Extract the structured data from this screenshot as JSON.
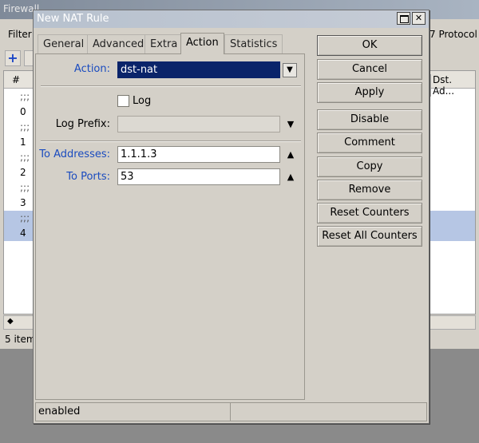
{
  "background": {
    "window_title": "Firewall",
    "tab_filter": "Filter",
    "tab_protocol": "7 Protocol",
    "col_hash": "#",
    "col_dst": "Dst. Ad...",
    "rows": [
      ";;;",
      "0",
      ";;;",
      "1",
      ";;;",
      "2",
      ";;;",
      "3",
      ";;;",
      "4"
    ],
    "status": "5 item"
  },
  "dialog": {
    "title": "New NAT Rule",
    "tabs": [
      "General",
      "Advanced",
      "Extra",
      "Action",
      "Statistics"
    ],
    "active_tab": "Action",
    "action_label": "Action:",
    "action_value": "dst-nat",
    "log_label": "Log",
    "log_checked": false,
    "log_prefix_label": "Log Prefix:",
    "log_prefix_value": "",
    "to_addresses_label": "To Addresses:",
    "to_addresses_value": "1.1.1.3",
    "to_ports_label": "To Ports:",
    "to_ports_value": "53",
    "buttons": [
      "OK",
      "Cancel",
      "Apply",
      "Disable",
      "Comment",
      "Copy",
      "Remove",
      "Reset Counters",
      "Reset All Counters"
    ],
    "status": "enabled"
  },
  "colors": {
    "label_blue": "#1a4bbf",
    "selection": "#0a246a"
  }
}
